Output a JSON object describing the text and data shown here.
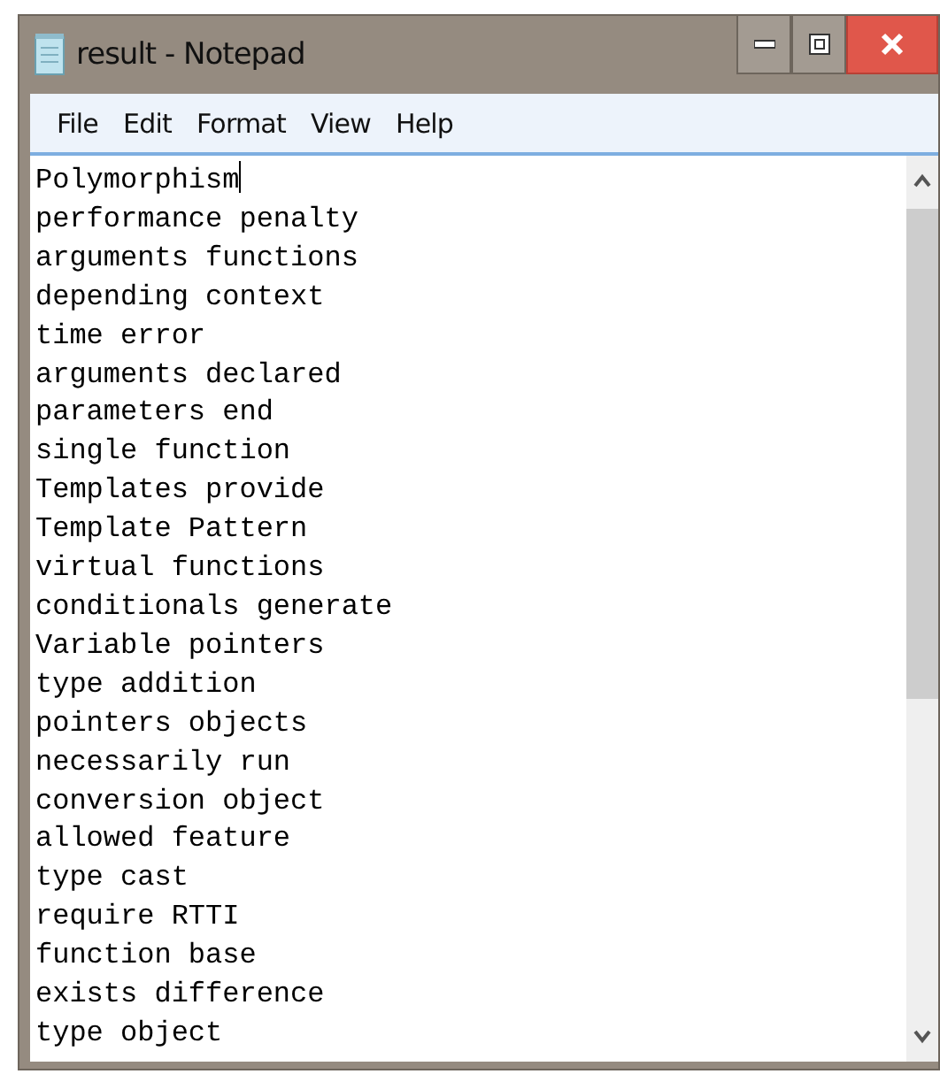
{
  "window": {
    "title": "result - Notepad"
  },
  "menu": [
    "File",
    "Edit",
    "Format",
    "View",
    "Help"
  ],
  "editor": {
    "lines": [
      "Polymorphism",
      "performance penalty",
      "arguments functions",
      "depending context",
      "time error",
      "arguments declared",
      "parameters end",
      "single function",
      "Templates provide",
      "Template Pattern",
      "virtual functions",
      "conditionals generate",
      "Variable pointers",
      "type addition",
      "pointers objects",
      "necessarily run",
      "conversion object",
      "allowed feature",
      "type cast",
      "require RTTI",
      "function base",
      "exists difference",
      "type object"
    ]
  }
}
